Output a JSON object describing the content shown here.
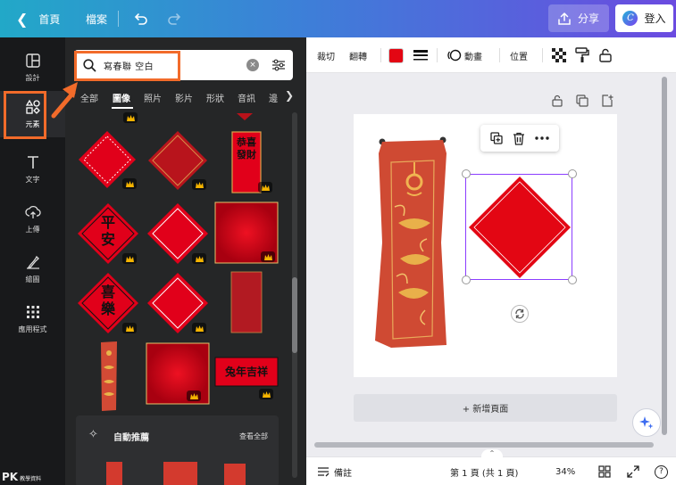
{
  "topbar": {
    "back_label": "首頁",
    "file_label": "檔案",
    "share_label": "分享",
    "login_label": "登入",
    "logo_letter": "C"
  },
  "rail": {
    "items": [
      {
        "label": "設計",
        "icon": "layout-icon"
      },
      {
        "label": "元素",
        "icon": "shapes-icon"
      },
      {
        "label": "文字",
        "icon": "text-icon"
      },
      {
        "label": "上傳",
        "icon": "upload-icon"
      },
      {
        "label": "繪圖",
        "icon": "draw-icon"
      },
      {
        "label": "應用程式",
        "icon": "apps-icon"
      }
    ],
    "watermark": "PK",
    "watermark_sub": "教學資料"
  },
  "panel": {
    "search_value": "寫春聯 空白",
    "clear_glyph": "×",
    "tabs": [
      "全部",
      "圖像",
      "照片",
      "影片",
      "形狀",
      "音訊",
      "邊"
    ],
    "active_tab": "圖像",
    "tiles": [
      "恭喜發財",
      "平安",
      "喜樂",
      "兔年吉祥"
    ],
    "recommend": {
      "title": "自動推薦",
      "see_all": "查看全部"
    }
  },
  "toolbar": {
    "crop": "裁切",
    "flip": "翻轉",
    "animate": "動畫",
    "position": "位置",
    "color": "#e30613"
  },
  "canvas": {
    "add_page": "+ 新增頁面"
  },
  "bottombar": {
    "notes": "備註",
    "page_indicator": "第 1 頁 (共 1 頁)",
    "zoom": "34%",
    "help": "?"
  },
  "colors": {
    "accent_orange": "#f26b2a",
    "selection": "#8b3dff",
    "red": "#e30613",
    "dark_panel": "#252627"
  }
}
